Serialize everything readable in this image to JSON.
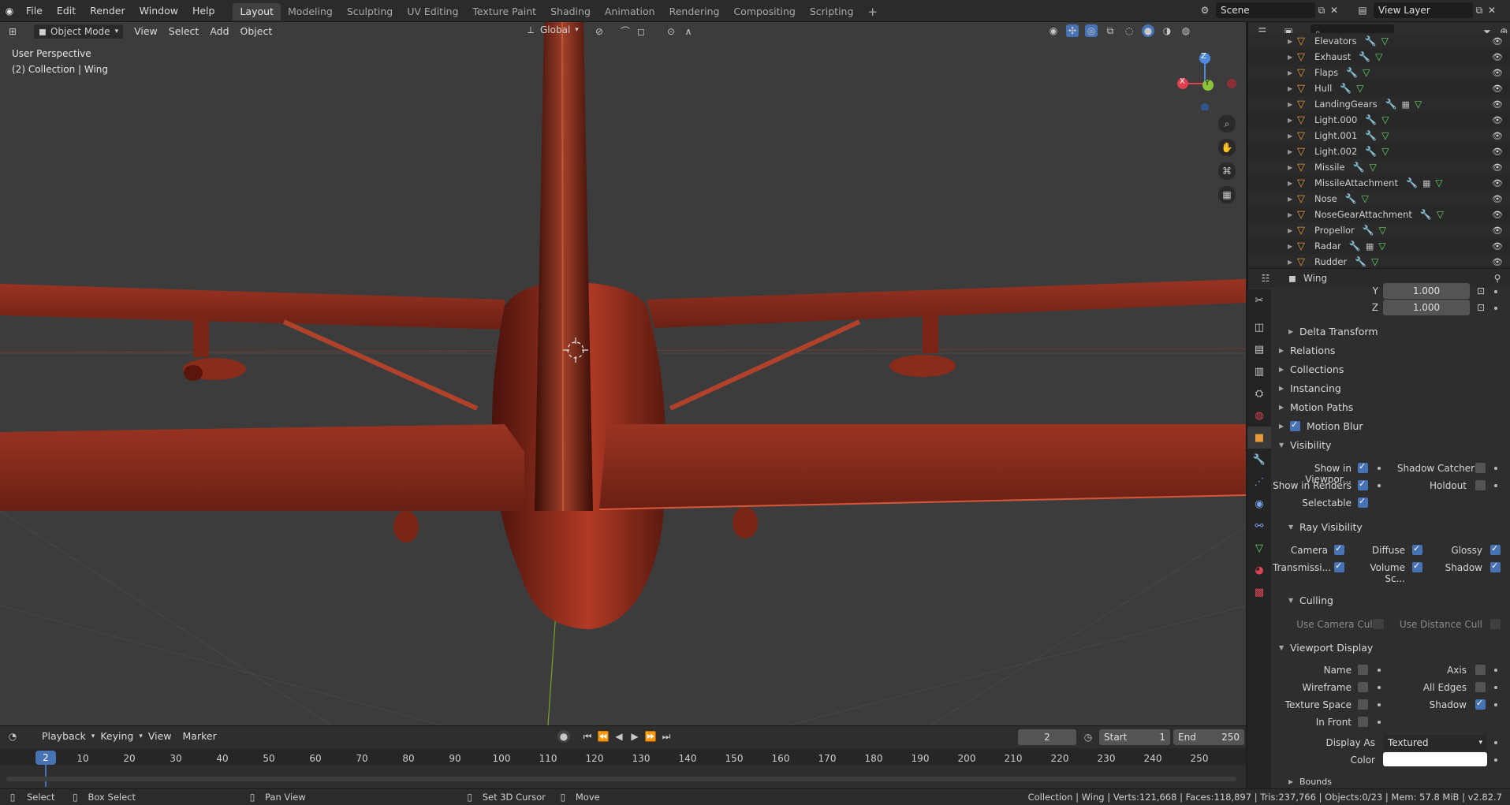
{
  "topbar": {
    "menus": [
      "File",
      "Edit",
      "Render",
      "Window",
      "Help"
    ],
    "workspaces": [
      "Layout",
      "Modeling",
      "Sculpting",
      "UV Editing",
      "Texture Paint",
      "Shading",
      "Animation",
      "Rendering",
      "Compositing",
      "Scripting"
    ],
    "add_tab": "+",
    "scene": "Scene",
    "view_layer": "View Layer"
  },
  "viewport": {
    "mode": "Object Mode",
    "menus": [
      "View",
      "Select",
      "Add",
      "Object"
    ],
    "orientation": "Global",
    "perspective_label": "User Perspective",
    "collection_label": "(2) Collection | Wing",
    "gizmo": {
      "x": "X",
      "y": "Y",
      "z": "Z"
    }
  },
  "outliner": {
    "search_placeholder": "",
    "items": [
      {
        "name": "Elevators",
        "extra": false
      },
      {
        "name": "Exhaust",
        "extra": false
      },
      {
        "name": "Flaps",
        "extra": false
      },
      {
        "name": "Hull",
        "extra": false
      },
      {
        "name": "LandingGears",
        "extra": true
      },
      {
        "name": "Light.000",
        "extra": false
      },
      {
        "name": "Light.001",
        "extra": false
      },
      {
        "name": "Light.002",
        "extra": false
      },
      {
        "name": "Missile",
        "extra": false
      },
      {
        "name": "MissileAttachment",
        "extra": true
      },
      {
        "name": "Nose",
        "extra": false
      },
      {
        "name": "NoseGearAttachment",
        "extra": false
      },
      {
        "name": "Propellor",
        "extra": false
      },
      {
        "name": "Radar",
        "extra": true
      },
      {
        "name": "Rudder",
        "extra": false
      }
    ]
  },
  "properties": {
    "object_name": "Wing",
    "scale_y_label": "Y",
    "scale_y": "1.000",
    "scale_z_label": "Z",
    "scale_z": "1.000",
    "sections": {
      "delta": "Delta Transform",
      "relations": "Relations",
      "collections": "Collections",
      "instancing": "Instancing",
      "motion_paths": "Motion Paths",
      "motion_blur": "Motion Blur",
      "visibility": "Visibility",
      "ray_visibility": "Ray Visibility",
      "culling": "Culling",
      "viewport_display": "Viewport Display",
      "bounds": "Bounds"
    },
    "visibility": {
      "show_viewport": "Show in Viewpor...",
      "show_renders": "Show in Renders",
      "selectable": "Selectable",
      "shadow_catcher": "Shadow Catcher",
      "holdout": "Holdout"
    },
    "ray": {
      "camera": "Camera",
      "diffuse": "Diffuse",
      "glossy": "Glossy",
      "transmission": "Transmissi...",
      "volume": "Volume Sc...",
      "shadow": "Shadow"
    },
    "culling": {
      "camera_cull": "Use Camera Cull",
      "distance_cull": "Use Distance Cull"
    },
    "display": {
      "name": "Name",
      "axis": "Axis",
      "wireframe": "Wireframe",
      "all_edges": "All Edges",
      "texture_space": "Texture Space",
      "shadow": "Shadow",
      "in_front": "In Front",
      "display_as_label": "Display As",
      "display_as": "Textured",
      "color_label": "Color"
    }
  },
  "timeline": {
    "menus": [
      "Playback",
      "Keying",
      "View",
      "Marker"
    ],
    "current_frame": "2",
    "start_label": "Start",
    "start": "1",
    "end_label": "End",
    "end": "250",
    "ticks": [
      "10",
      "20",
      "30",
      "40",
      "50",
      "60",
      "70",
      "80",
      "90",
      "100",
      "110",
      "120",
      "130",
      "140",
      "150",
      "160",
      "170",
      "180",
      "190",
      "200",
      "210",
      "220",
      "230",
      "240",
      "250"
    ]
  },
  "status": {
    "select": "Select",
    "box_select": "Box Select",
    "pan_view": "Pan View",
    "set_cursor": "Set 3D Cursor",
    "move": "Move",
    "stats": "Collection | Wing | Verts:121,668 | Faces:118,897 | Tris:237,766 | Objects:0/23 | Mem: 57.8 MiB | v2.82.7"
  },
  "colors": {
    "accent": "#4772b3",
    "active_object": "#e79a3a",
    "plane": "#8c2a1c"
  }
}
